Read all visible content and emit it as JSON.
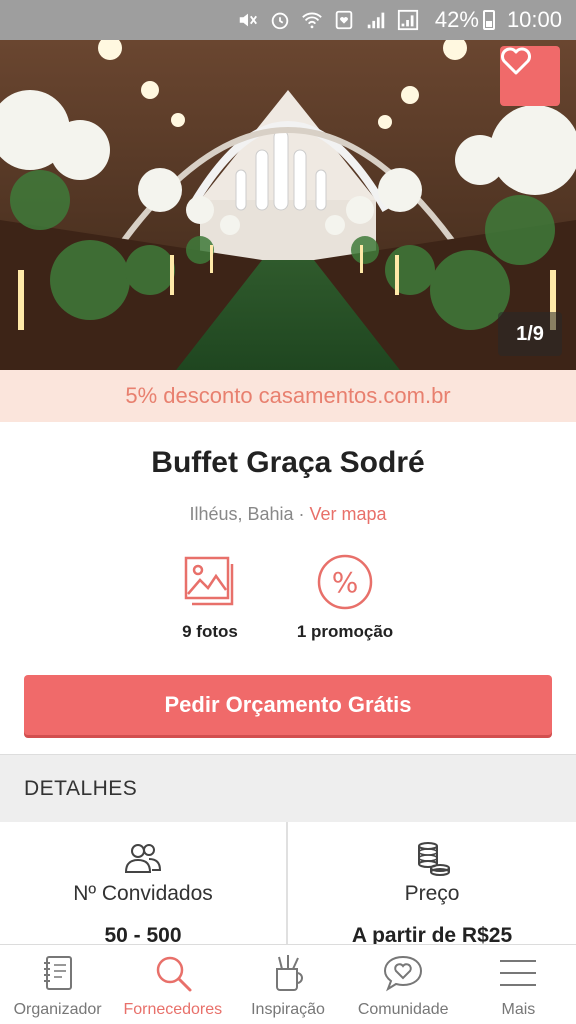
{
  "status_bar": {
    "battery": "42%",
    "time": "10:00"
  },
  "hero": {
    "counter": "1/9",
    "favorite_icon": "heart-icon"
  },
  "promo": {
    "text": "5% desconto casamentos.com.br"
  },
  "vendor": {
    "name": "Buffet Graça Sodré",
    "location": "Ilhéus, Bahia",
    "separator": " · ",
    "map_link": "Ver mapa"
  },
  "stats": [
    {
      "label": "9 fotos",
      "icon": "photos-icon"
    },
    {
      "label": "1 promoção",
      "icon": "percent-icon"
    }
  ],
  "cta": {
    "label": "Pedir Orçamento Grátis"
  },
  "details": {
    "header": "DETALHES",
    "cells": [
      {
        "label": "Nº Convidados",
        "value": "50 - 500",
        "icon": "guests-icon"
      },
      {
        "label": "Preço",
        "value": "A partir de R$25",
        "icon": "coins-icon"
      }
    ]
  },
  "bottom_nav": {
    "items": [
      {
        "label": "Organizador",
        "icon": "notebook-icon",
        "active": false
      },
      {
        "label": "Fornecedores",
        "icon": "search-icon",
        "active": true
      },
      {
        "label": "Inspiração",
        "icon": "pencil-cup-icon",
        "active": false
      },
      {
        "label": "Comunidade",
        "icon": "chat-heart-icon",
        "active": false
      },
      {
        "label": "Mais",
        "icon": "menu-icon",
        "active": false
      }
    ]
  },
  "colors": {
    "accent": "#f06a6a",
    "accent_text": "#e8706a",
    "promo_bg": "#fbe5dc",
    "status_bar": "#9e9e9e"
  }
}
